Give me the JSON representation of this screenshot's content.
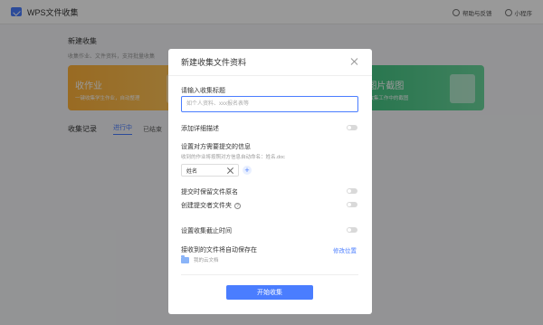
{
  "app": {
    "title": "WPS文件收集",
    "help_feedback": "帮助与反馈",
    "mini_program": "小程序"
  },
  "background": {
    "section_title": "新建收集",
    "section_desc": "收集作业、文件资料，支持批量收集",
    "cards": [
      {
        "title": "收作业",
        "sub": "一键收集学生作业，自动整理"
      },
      {
        "title": "",
        "sub": ""
      },
      {
        "title": "收图片截图",
        "sub": "一键收集工作中的截图"
      }
    ],
    "tabs_lead": "收集记录",
    "tabs": [
      "进行中",
      "已结束"
    ]
  },
  "modal": {
    "title": "新建收集文件资料",
    "collect_title_label": "请输入收集标题",
    "collect_title_placeholder": "如个人资料、xxx报名表等",
    "add_description_label": "添加详细描述",
    "info_label": "设置对方需要提交的信息",
    "info_hint": "收到的作业将按照对方信息自动命名：姓名.doc",
    "fields": [
      "姓名"
    ],
    "add_field_symbol": "+",
    "keep_filename_label": "提交时保留文件原名",
    "create_folder_label": "创建提交者文件夹",
    "help_symbol": "?",
    "deadline_label": "设置收集截止时间",
    "save_location_label": "接收到的文件将自动保存在",
    "modify_location_label": "修改位置",
    "folder_name": "我的云文档",
    "start_button": "开始收集"
  },
  "colors": {
    "accent": "#4a7dff",
    "toggle_off": "#d9d9d9"
  }
}
